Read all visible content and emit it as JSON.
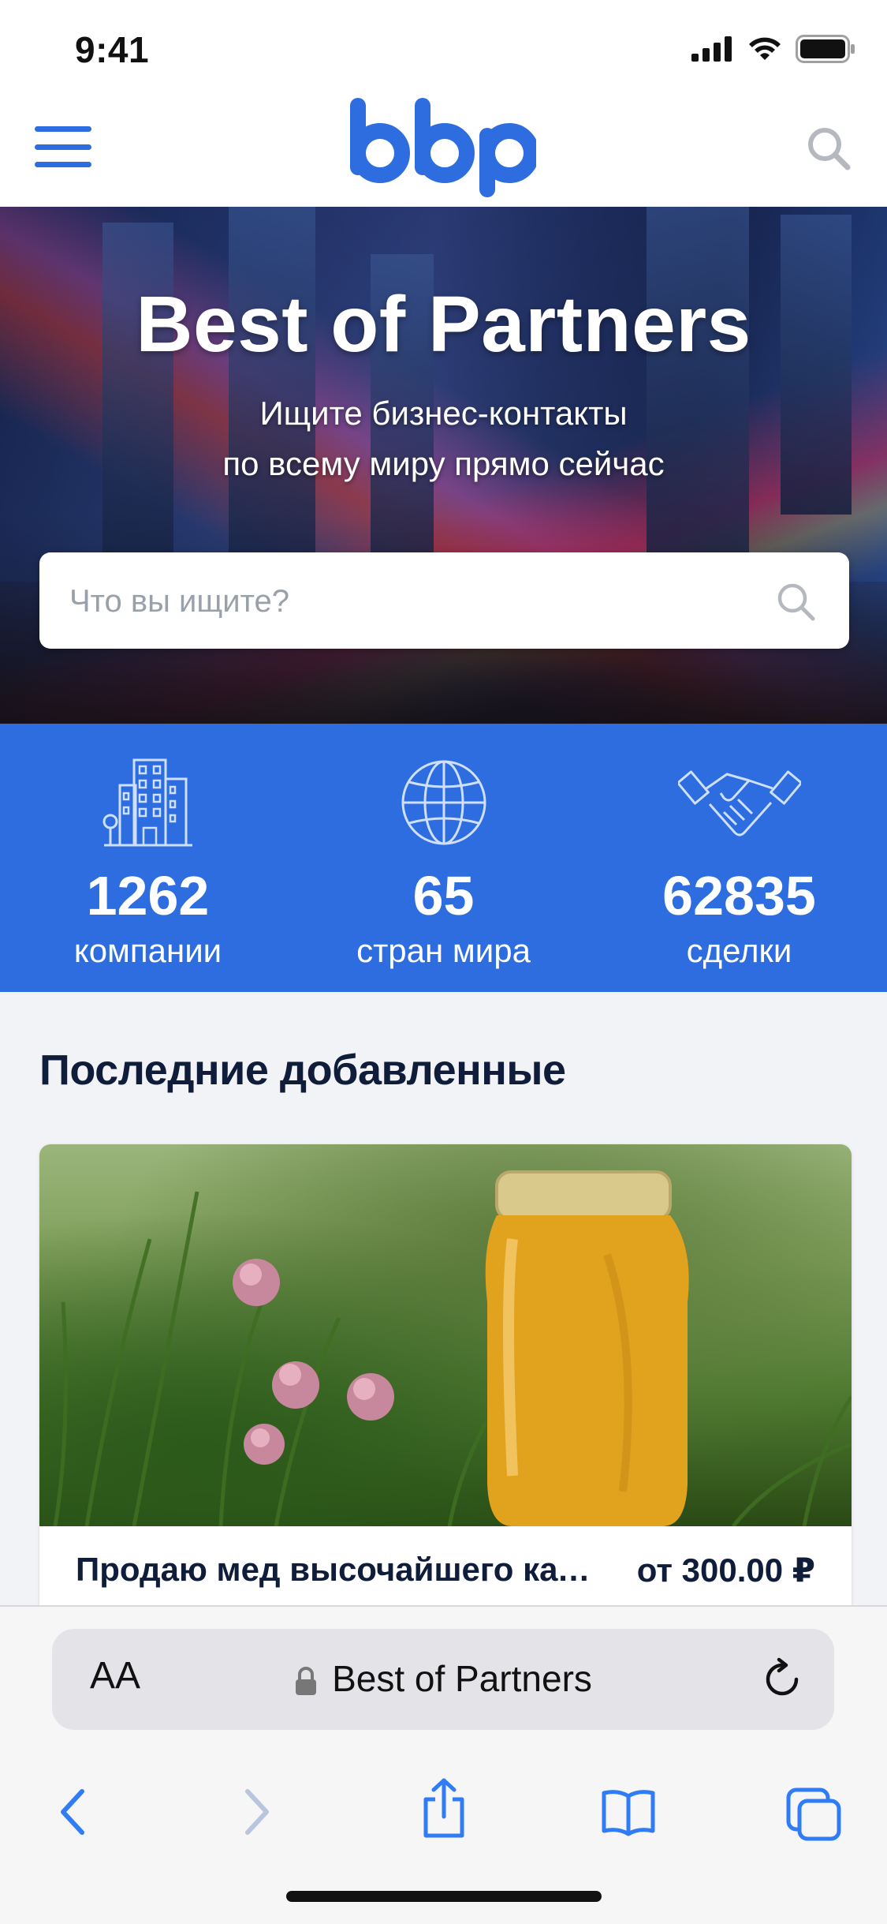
{
  "status_bar": {
    "time": "9:41"
  },
  "header": {
    "logo": "bbp",
    "menu_icon": "hamburger-icon",
    "search_icon": "search-icon"
  },
  "hero": {
    "title": "Best of Partners",
    "subtitle_line1": "Ищите бизнес-контакты",
    "subtitle_line2": "по всему миру прямо сейчас",
    "search_placeholder": "Что вы ищите?"
  },
  "stats": [
    {
      "icon": "buildings-icon",
      "value": "1262",
      "label": "компании"
    },
    {
      "icon": "globe-icon",
      "value": "65",
      "label": "стран мира"
    },
    {
      "icon": "handshake-icon",
      "value": "62835",
      "label": "сделки"
    }
  ],
  "latest": {
    "title": "Последние добавленные",
    "items": [
      {
        "title": "Продаю мед высочайшего качества",
        "price": "от 300.00 ₽"
      }
    ]
  },
  "safari": {
    "aa_label": "AA",
    "url_label": "Best of Partners"
  },
  "colors": {
    "brand_blue": "#2d6ddf",
    "heading_navy": "#0f1d3a"
  }
}
